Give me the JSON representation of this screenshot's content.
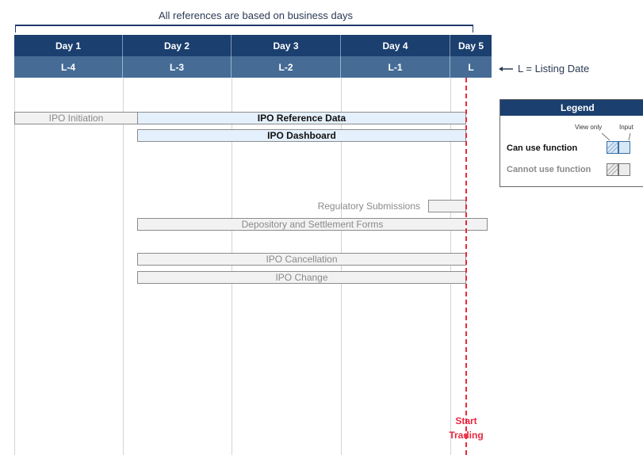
{
  "caption": "All references are based on business days",
  "days": [
    {
      "day": "Day 1",
      "label": "L-4"
    },
    {
      "day": "Day 2",
      "label": "L-3"
    },
    {
      "day": "Day 3",
      "label": "L-2"
    },
    {
      "day": "Day 4",
      "label": "L-1"
    },
    {
      "day": "Day 5",
      "label": "L"
    }
  ],
  "bars": {
    "ipo_initiation": "IPO Initiation",
    "ipo_reference_data": "IPO Reference Data",
    "ipo_dashboard": "IPO Dashboard",
    "regulatory_submissions": "Regulatory Submissions",
    "depository_forms": "Depository and Settlement Forms",
    "ipo_cancellation": "IPO Cancellation",
    "ipo_change": "IPO Change"
  },
  "start_trading": {
    "line1": "Start",
    "line2": "Trading"
  },
  "listing_note": "L = Listing Date",
  "legend": {
    "title": "Legend",
    "view_only": "View only",
    "input": "Input",
    "can_use": "Can use function",
    "cannot_use": "Cannot use function"
  },
  "colors": {
    "header_dark": "#1b3f6e",
    "header_light": "#466c96",
    "can_use_fill": "#e4f0fb",
    "cannot_use_fill": "#f2f2f2",
    "start_trading_red": "#e8273f"
  }
}
